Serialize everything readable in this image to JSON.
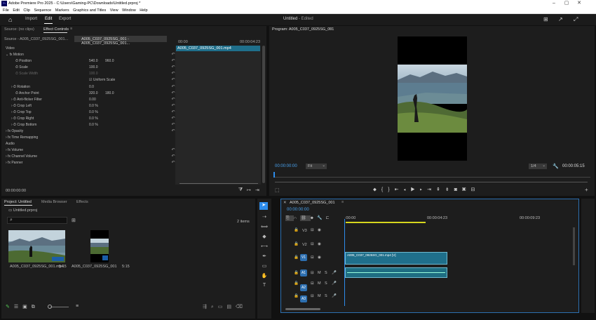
{
  "titlebar": {
    "title": "Adobe Premiere Pro 2025 - C:\\Users\\Gaming-PC\\Downloads\\Untitled.prproj *",
    "min": "–",
    "max": "▢",
    "close": "✕"
  },
  "menu": [
    "File",
    "Edit",
    "Clip",
    "Sequence",
    "Markers",
    "Graphics and Titles",
    "View",
    "Window",
    "Help"
  ],
  "header": {
    "tabs": [
      "Import",
      "Edit",
      "Export"
    ],
    "active": "Edit",
    "doc_title": "Untitled",
    "doc_status": "- Edited"
  },
  "source_panel": {
    "tab_source": "Source: (no clips)",
    "tab_effect": "Effect Controls",
    "menu": "≡",
    "master": "Source - A005_C037_0925SG_001...",
    "clip": "A005_C037_0925SG_001 - A005_C037_0925SG_001...",
    "time_zero": "00:00",
    "time_end": "00:00:04:23",
    "clip_bar": "A005_C037_0925SG_001.mp4",
    "footer_time": "00:00:00:00"
  },
  "effects": {
    "video": "Video",
    "motion": "Motion",
    "position": "Position",
    "pos_x": "540.0",
    "pos_y": "960.0",
    "scale": "Scale",
    "scale_v": "100.0",
    "scale_width": "Scale Width",
    "scale_width_v": "100.0",
    "uniform": "Uniform Scale",
    "rotation": "Rotation",
    "rotation_v": "0.0",
    "anchor": "Anchor Point",
    "anchor_x": "320.0",
    "anchor_y": "180.0",
    "antiflicker": "Anti-flicker Filter",
    "antiflicker_v": "0.00",
    "crop_left": "Crop Left",
    "crop_top": "Crop Top",
    "crop_right": "Crop Right",
    "crop_bottom": "Crop Bottom",
    "crop_v": "0.0 %",
    "opacity": "Opacity",
    "time_remap": "Time Remapping",
    "audio": "Audio",
    "volume": "Volume",
    "channel_volume": "Channel Volume",
    "panner": "Panner"
  },
  "program": {
    "title": "Program: A005_C037_0925SG_001",
    "menu": "≡",
    "timecode": "00:00:00:00",
    "fit": "Fit",
    "quality": "1/4",
    "duration": "00:00:05:15"
  },
  "project": {
    "tab_project": "Project: Untitled",
    "tab_media": "Media Browser",
    "tab_effects": "Effects",
    "file": "Untitled.prproj",
    "items": "2 items",
    "clips": [
      {
        "name": "A005_C037_0925SG_001.mp4",
        "dur": "5:15"
      },
      {
        "name": "A005_C037_0925SG_001",
        "dur": "5:15"
      }
    ]
  },
  "timeline": {
    "seq_name": "A005_C037_0925SG_001",
    "menu": "≡",
    "timecode": "00:00:00:00",
    "ruler": [
      ":00:00",
      "00:00:04:23",
      "00:00:09:23"
    ],
    "video_tracks": [
      "V3",
      "V2",
      "V1"
    ],
    "audio_tracks": [
      "A1",
      "A2",
      "A3"
    ],
    "video_clip": "A005_C037_0925SG_001.mp4 [V]"
  },
  "colors": {
    "accent": "#2d8ceb",
    "clip_video": "#1f6f8b",
    "clip_audio": "#1e6e82"
  }
}
